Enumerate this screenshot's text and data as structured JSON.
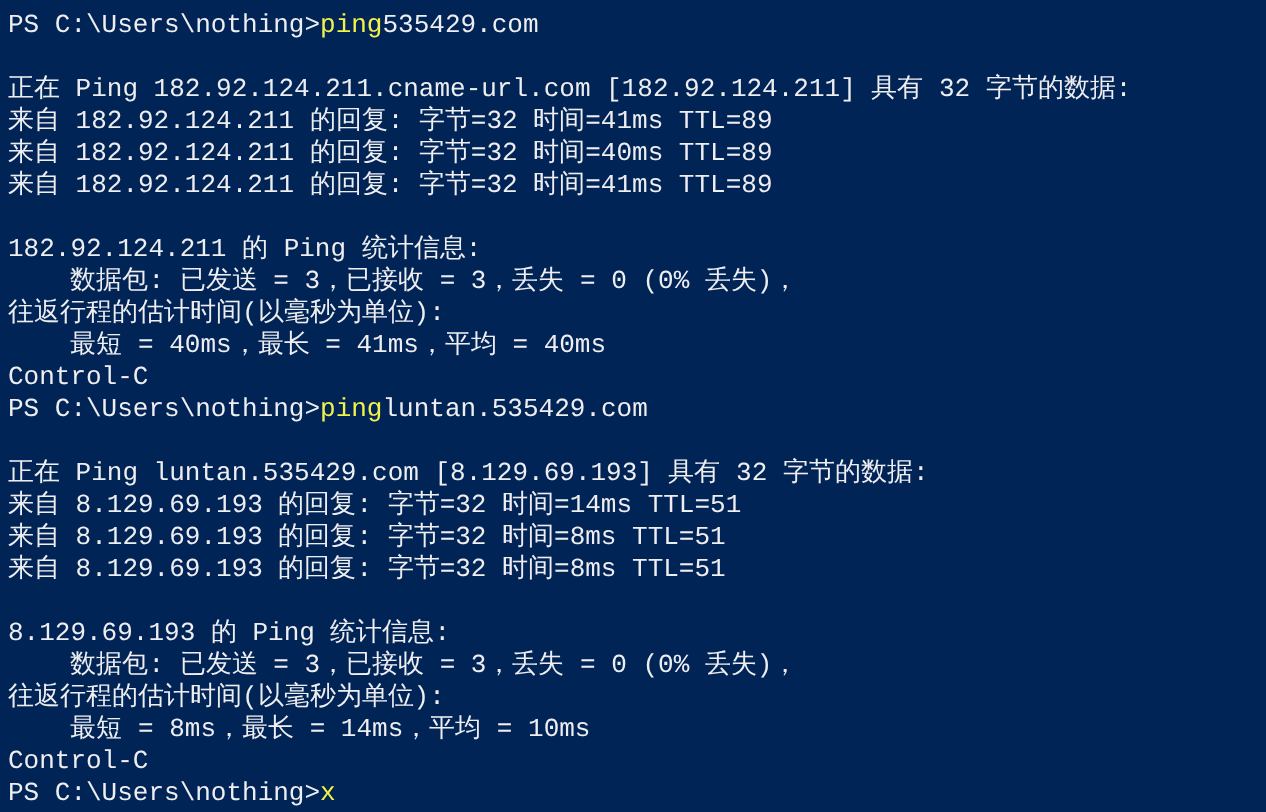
{
  "console": {
    "lines": [
      {
        "kind": "prompt",
        "prompt": "PS C:\\Users\\nothing>",
        "command": "ping",
        "args": "535429.com"
      },
      {
        "kind": "blank"
      },
      {
        "kind": "output",
        "text": "正在 Ping 182.92.124.211.cname-url.com [182.92.124.211] 具有 32 字节的数据:"
      },
      {
        "kind": "output",
        "text": "来自 182.92.124.211 的回复: 字节=32 时间=41ms TTL=89"
      },
      {
        "kind": "output",
        "text": "来自 182.92.124.211 的回复: 字节=32 时间=40ms TTL=89"
      },
      {
        "kind": "output",
        "text": "来自 182.92.124.211 的回复: 字节=32 时间=41ms TTL=89"
      },
      {
        "kind": "blank"
      },
      {
        "kind": "output",
        "text": "182.92.124.211 的 Ping 统计信息:"
      },
      {
        "kind": "output",
        "text": "    数据包: 已发送 = 3，已接收 = 3，丢失 = 0 (0% 丢失)，"
      },
      {
        "kind": "output",
        "text": "往返行程的估计时间(以毫秒为单位):"
      },
      {
        "kind": "output",
        "text": "    最短 = 40ms，最长 = 41ms，平均 = 40ms"
      },
      {
        "kind": "output",
        "text": "Control-C"
      },
      {
        "kind": "prompt",
        "prompt": "PS C:\\Users\\nothing>",
        "command": "ping",
        "args": "luntan.535429.com"
      },
      {
        "kind": "blank"
      },
      {
        "kind": "output",
        "text": "正在 Ping luntan.535429.com [8.129.69.193] 具有 32 字节的数据:"
      },
      {
        "kind": "output",
        "text": "来自 8.129.69.193 的回复: 字节=32 时间=14ms TTL=51"
      },
      {
        "kind": "output",
        "text": "来自 8.129.69.193 的回复: 字节=32 时间=8ms TTL=51"
      },
      {
        "kind": "output",
        "text": "来自 8.129.69.193 的回复: 字节=32 时间=8ms TTL=51"
      },
      {
        "kind": "blank"
      },
      {
        "kind": "output",
        "text": "8.129.69.193 的 Ping 统计信息:"
      },
      {
        "kind": "output",
        "text": "    数据包: 已发送 = 3，已接收 = 3，丢失 = 0 (0% 丢失)，"
      },
      {
        "kind": "output",
        "text": "往返行程的估计时间(以毫秒为单位):"
      },
      {
        "kind": "output",
        "text": "    最短 = 8ms，最长 = 14ms，平均 = 10ms"
      },
      {
        "kind": "output",
        "text": "Control-C"
      },
      {
        "kind": "prompt",
        "prompt": "PS C:\\Users\\nothing>",
        "command": "x"
      }
    ]
  }
}
